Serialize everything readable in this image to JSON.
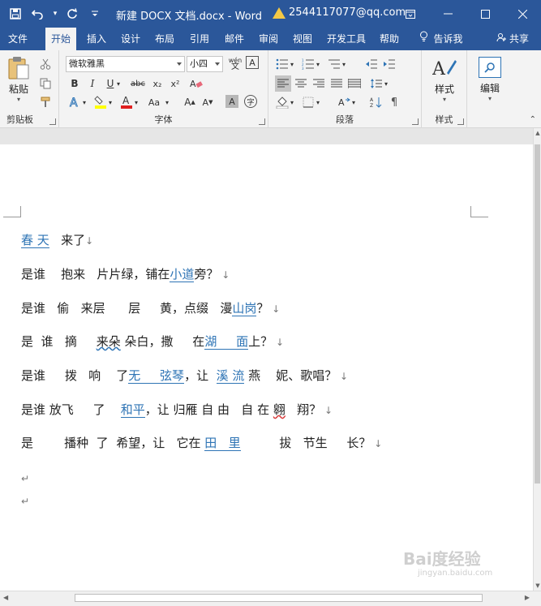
{
  "titlebar": {
    "title": "新建 DOCX 文档.docx  -  Word",
    "account": "2544117077@qq.com",
    "qat": [
      {
        "name": "save-icon",
        "glyph": "💾"
      },
      {
        "name": "undo-icon",
        "glyph": "↶"
      },
      {
        "name": "redo-icon",
        "glyph": "↻"
      },
      {
        "name": "customize-qat-icon",
        "glyph": "⌄"
      }
    ],
    "window_controls": [
      {
        "name": "ribbon-display-options-icon",
        "glyph": "⊡"
      },
      {
        "name": "minimize-icon",
        "glyph": "—"
      },
      {
        "name": "maximize-icon",
        "glyph": "☐"
      },
      {
        "name": "close-icon",
        "glyph": "✕"
      }
    ]
  },
  "tabs": [
    {
      "label": "文件",
      "active": false
    },
    {
      "label": "开始",
      "active": true
    },
    {
      "label": "插入",
      "active": false
    },
    {
      "label": "设计",
      "active": false
    },
    {
      "label": "布局",
      "active": false
    },
    {
      "label": "引用",
      "active": false
    },
    {
      "label": "邮件",
      "active": false
    },
    {
      "label": "审阅",
      "active": false
    },
    {
      "label": "视图",
      "active": false
    },
    {
      "label": "开发工具",
      "active": false
    },
    {
      "label": "帮助",
      "active": false
    },
    {
      "label": "告诉我",
      "active": false
    }
  ],
  "share_label": "共享",
  "ribbon": {
    "clipboard": {
      "label": "剪贴板",
      "paste": "粘贴"
    },
    "font": {
      "label": "字体",
      "font_name": "微软雅黑",
      "font_size": "小四",
      "buttons": [
        "B",
        "I",
        "U",
        "abc",
        "x₂",
        "x²"
      ],
      "pinyin": "wén"
    },
    "paragraph": {
      "label": "段落"
    },
    "styles": {
      "label": "样式",
      "button": "样式"
    },
    "editing": {
      "label": "编辑",
      "button": "编辑"
    }
  },
  "document": {
    "lines": [
      [
        {
          "t": "春 天",
          "s": "link"
        },
        {
          "t": "   来了",
          "s": ""
        },
        {
          "t": "↓",
          "s": "pmark"
        }
      ],
      [
        {
          "t": "是谁    抱来   片片绿，铺在",
          "s": ""
        },
        {
          "t": "小道",
          "s": "link"
        },
        {
          "t": "旁？",
          "s": ""
        },
        {
          "t": " ↓",
          "s": "pmark"
        }
      ],
      [
        {
          "t": "是谁   偷   来层      层     黄，点缀   漫",
          "s": ""
        },
        {
          "t": "山岗",
          "s": "link"
        },
        {
          "t": "？",
          "s": ""
        },
        {
          "t": " ↓",
          "s": "pmark"
        }
      ],
      [
        {
          "t": "是  谁   摘     ",
          "s": ""
        },
        {
          "t": "来朵",
          "s": "squig"
        },
        {
          "t": " 朵白，撒     在",
          "s": ""
        },
        {
          "t": "湖     面",
          "s": "link"
        },
        {
          "t": "上？",
          "s": ""
        },
        {
          "t": " ↓",
          "s": "pmark"
        }
      ],
      [
        {
          "t": "是谁     拨   响    了",
          "s": ""
        },
        {
          "t": "无     弦琴",
          "s": "link"
        },
        {
          "t": "，让  ",
          "s": ""
        },
        {
          "t": "溪 流",
          "s": "link"
        },
        {
          "t": " 燕    妮、歌唱？",
          "s": ""
        },
        {
          "t": " ↓",
          "s": "pmark"
        }
      ],
      [
        {
          "t": "是谁 放飞     了    ",
          "s": ""
        },
        {
          "t": "和平",
          "s": "link"
        },
        {
          "t": "，让 归雁 自 由   自 在 ",
          "s": ""
        },
        {
          "t": "翱",
          "s": "squig-red"
        },
        {
          "t": "   翔？",
          "s": ""
        },
        {
          "t": " ↓",
          "s": "pmark"
        }
      ],
      [
        {
          "t": "是        播种  了  希望，让   它在 ",
          "s": ""
        },
        {
          "t": "田   里",
          "s": "link"
        },
        {
          "t": "          拔   节生     长？",
          "s": ""
        },
        {
          "t": " ↓",
          "s": "pmark"
        }
      ],
      [
        {
          "t": "↵",
          "s": "pmark"
        }
      ],
      [
        {
          "t": "↵",
          "s": "pmark"
        }
      ]
    ]
  },
  "watermark": {
    "main": "Bai度经验",
    "sub": "jingyan.baidu.com"
  }
}
